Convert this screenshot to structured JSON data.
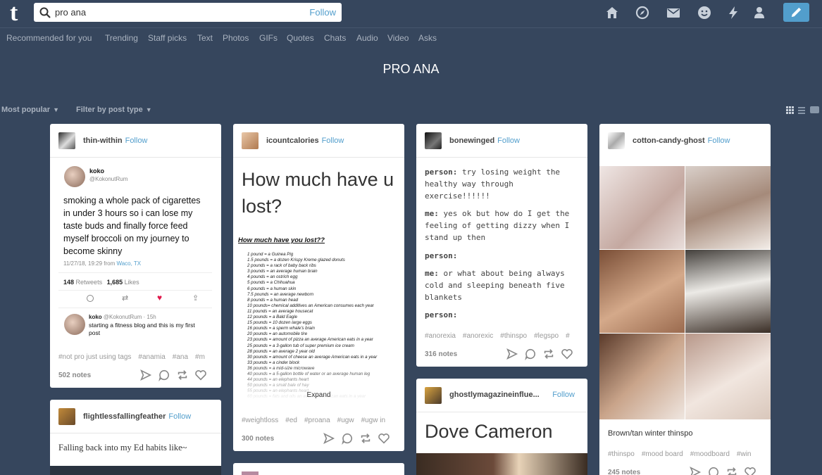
{
  "header": {
    "logo": "t",
    "search_value": "pro ana",
    "search_follow": "Follow"
  },
  "subnav": [
    "Recommended for you",
    "Trending",
    "Staff picks",
    "Text",
    "Photos",
    "GIFs",
    "Quotes",
    "Chats",
    "Audio",
    "Video",
    "Asks"
  ],
  "page_title": "PRO ANA",
  "controls": {
    "sort": "Most popular",
    "filter": "Filter by post type"
  },
  "colors": {
    "bg": "#36465d",
    "accent": "#529ecc",
    "like": "#e0174a"
  },
  "icons": [
    "home-icon",
    "explore-icon",
    "mail-icon",
    "activity-icon",
    "lightning-icon",
    "account-icon",
    "compose-icon",
    "grid-view-icon",
    "list-view-icon",
    "tv-icon"
  ],
  "posts": {
    "p1": {
      "user": "thin-within",
      "follow": "Follow",
      "tweet": {
        "name": "koko",
        "handle": "@KokonutRum",
        "text": "smoking a whole pack of cigarettes in under 3 hours so i can lose my taste buds and finally force feed myself broccoli on my journey to become skinny",
        "time": "11/27/18, 19:29 from",
        "place": "Waco, TX",
        "retweets": "148",
        "retweets_label": "Retweets",
        "likes": "1,685",
        "likes_label": "Likes",
        "reply": {
          "name": "koko",
          "meta": "@KokonutRum · 15h",
          "text": "starting a fitness blog and this is my first post"
        }
      },
      "tags": [
        "#not pro just using tags",
        "#anamia",
        "#ana",
        "#m"
      ],
      "notes": "502 notes"
    },
    "p2": {
      "user": "flightlessfallingfeather",
      "follow": "Follow",
      "text": "Falling back into my Ed habits like~"
    },
    "p3": {
      "user": "icountcalories",
      "follow": "Follow",
      "title": "How much have u lost?",
      "subtitle": "How much have you lost??",
      "list": [
        "1 pound = a Guinea Pig",
        "1.5 pounds = a dozen Krispy Kreme glazed donuts",
        "2 pounds = a rack of baby back ribs",
        "3 pounds = an average human brain",
        "4 pounds = an ostrich egg",
        "5 pounds = a Chihuahua",
        "6 pounds = a human skin",
        "7.5 pounds = an average newborn",
        "8 pounds = a human head",
        "10 pounds= chemical additives an American consumes each year",
        "11 pounds = an average housecat",
        "12 pounds = a Bald Eagle",
        "15 pounds = 10 dozen large eggs",
        "16 pounds = a sperm whale's brain",
        "20 pounds = an automobile tire",
        "23 pounds = amount of pizza an average American eats in a year",
        "25 pounds = a 3-gallon tub of super premium ice cream",
        "28 pounds = an average 2 year old",
        "30 pounds = amount of cheese an average American eats in a year",
        "33 pounds = a cinder block",
        "36 pounds = a mid-size microwave",
        "40 pounds = a 5-gallon bottle of water or an average human leg",
        "44 pounds = an elephants heart",
        "50 pounds = a small bale of hay",
        "55 pounds = an elephants heart",
        "60 pounds = fats and oils an average American eats in a year"
      ],
      "expand": "Expand",
      "tags": [
        "#weightloss",
        "#ed",
        "#proana",
        "#ugw",
        "#ugw in"
      ],
      "notes": "300 notes"
    },
    "p4": {
      "user": "bonewinged",
      "follow": "Follow",
      "chat": [
        {
          "who": "person:",
          "line": "try losing weight the healthy way through exercise!!!!!!"
        },
        {
          "who": "me:",
          "line": "yes ok but how do I get the feeling of getting dizzy when I stand up then"
        },
        {
          "who": "person:",
          "line": ""
        },
        {
          "who": "me:",
          "line": "or what about being always cold and sleeping beneath five blankets"
        },
        {
          "who": "person:",
          "line": ""
        }
      ],
      "tags": [
        "#anorexia",
        "#anorexic",
        "#thinspo",
        "#legspo",
        "#"
      ],
      "notes": "316 notes"
    },
    "p5": {
      "user": "ghostlymagazineinflue...",
      "follow": "Follow",
      "title": "Dove Cameron"
    },
    "p6": {
      "user": "cotton-candy-ghost",
      "follow": "Follow",
      "caption": "Brown/tan winter thinspo",
      "tags": [
        "#thinspo",
        "#mood board",
        "#moodboard",
        "#win"
      ],
      "notes": "245 notes"
    }
  }
}
